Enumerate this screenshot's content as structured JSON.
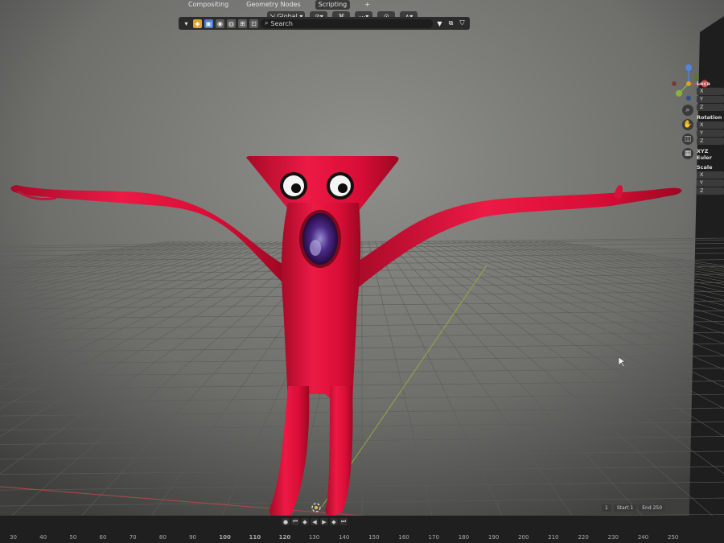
{
  "workspace_tabs": [
    {
      "label": "Compositing",
      "active": false
    },
    {
      "label": "Geometry Nodes",
      "active": false
    },
    {
      "label": "Scripting",
      "active": true
    }
  ],
  "add_workspace_label": "+",
  "transform_orientation": {
    "icon": "transform-orientation-icon",
    "value": "Global"
  },
  "search": {
    "label": "Search"
  },
  "npanel": {
    "location_label": "Loca",
    "rotation_label": "Rotation",
    "euler_label": "XYZ Euler",
    "scale_label": "Scale",
    "axes": [
      "X",
      "Y",
      "Z"
    ]
  },
  "frame_fields": {
    "current": "1",
    "start_label": "Start",
    "start_value": "1",
    "end_label": "End",
    "end_value": "250"
  },
  "timeline_ticks": [
    "30",
    "40",
    "50",
    "60",
    "70",
    "80",
    "90",
    "100",
    "110",
    "120",
    "130",
    "140",
    "150",
    "160",
    "170",
    "180",
    "190",
    "200",
    "210",
    "220",
    "230",
    "240",
    "250"
  ],
  "colors": {
    "character": "#e0103a",
    "viewport_bg": "#7e7f7a",
    "grid": "#5c5d59"
  }
}
